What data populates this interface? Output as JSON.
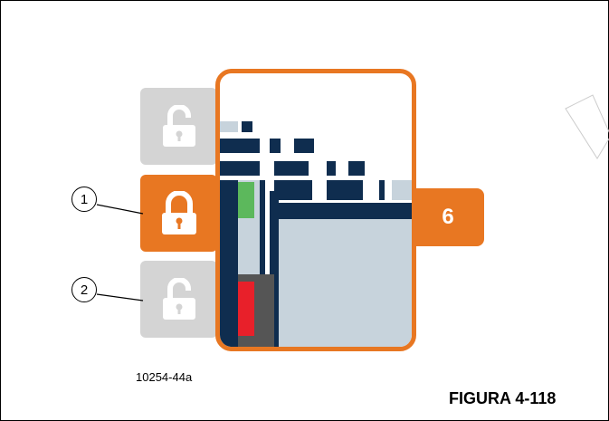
{
  "figure": {
    "part_number": "10254-44a",
    "figure_label": "FIGURA 4-118"
  },
  "callouts": [
    {
      "label": "1"
    },
    {
      "label": "2"
    }
  ],
  "lock_buttons": [
    {
      "icon": "unlock-icon",
      "state": "inactive",
      "color": "#d4d4d4"
    },
    {
      "icon": "lock-icon",
      "state": "active",
      "color": "#e87722"
    },
    {
      "icon": "unlock-icon",
      "state": "inactive",
      "color": "#d4d4d4"
    }
  ],
  "position_display": {
    "value": "6"
  },
  "colors": {
    "accent": "#e87722",
    "inactive": "#d4d4d4",
    "navy": "#0f2d4f",
    "light_area": "#c7d3dc",
    "green": "#5cb85c",
    "red": "#e8202a"
  }
}
